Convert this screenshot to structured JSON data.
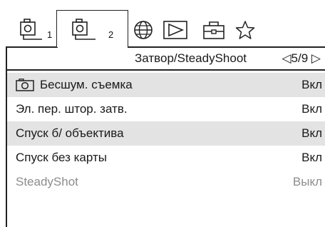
{
  "tabs": [
    {
      "icon": "camera1-icon",
      "number": "1"
    },
    {
      "icon": "camera2-icon",
      "number": "2",
      "active": true
    },
    {
      "icon": "globe-icon"
    },
    {
      "icon": "play-icon"
    },
    {
      "icon": "toolbox-icon"
    },
    {
      "icon": "star-icon"
    }
  ],
  "header": {
    "title": "Затвор/SteadyShoot",
    "page": "◁5/9 ▷"
  },
  "rows": [
    {
      "label": "Бесшум. съемка",
      "value": "Вкл",
      "icon": "camera-icon"
    },
    {
      "label": "Эл. пер. штор. затв.",
      "value": "Вкл"
    },
    {
      "label": "Спуск б/ объектива",
      "value": "Вкл"
    },
    {
      "label": "Спуск без карты",
      "value": "Вкл"
    },
    {
      "label": "SteadyShot",
      "value": "Выкл",
      "disabled": true
    }
  ]
}
